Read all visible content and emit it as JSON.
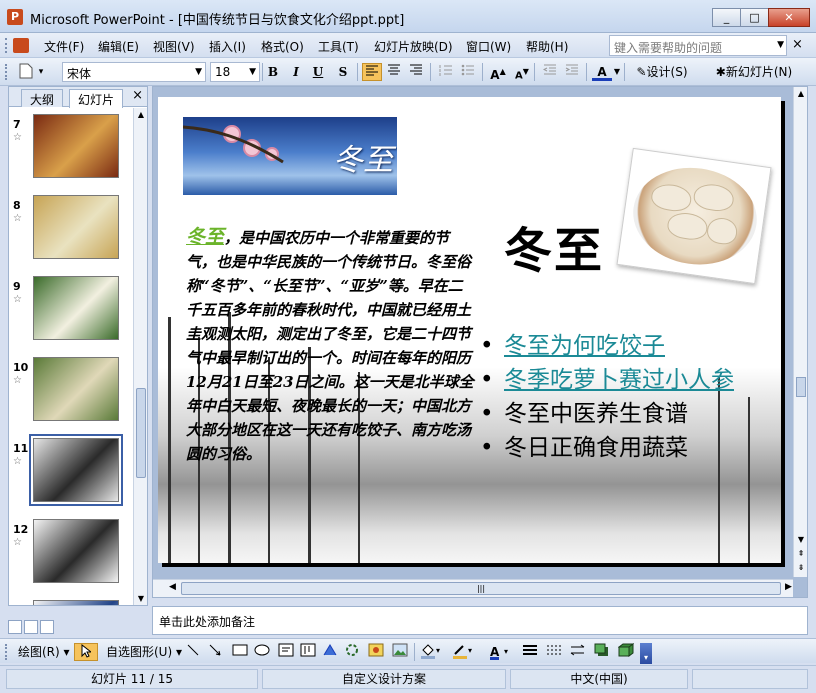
{
  "window": {
    "app_title": "Microsoft PowerPoint - [中国传统节日与饮食文化介绍ppt.ppt]",
    "min": "_",
    "restore": "□",
    "close": "✕"
  },
  "menu": {
    "items": [
      "文件(F)",
      "编辑(E)",
      "视图(V)",
      "插入(I)",
      "格式(O)",
      "工具(T)",
      "幻灯片放映(D)",
      "窗口(W)",
      "帮助(H)"
    ],
    "help_placeholder": "键入需要帮助的问题",
    "close": "×"
  },
  "toolbar": {
    "font": "宋体",
    "size": "18",
    "bold": "B",
    "italic": "I",
    "underline": "U",
    "shadow": "S",
    "design": "设计(S)",
    "new_slide": "新幻灯片(N)"
  },
  "panel": {
    "tab_outline": "大纲",
    "tab_slides": "幻灯片",
    "close": "×"
  },
  "slides": [
    {
      "num": "7",
      "colors": [
        "#7a2a12",
        "#d9a04a"
      ]
    },
    {
      "num": "8",
      "colors": [
        "#c7a455",
        "#e9e2c0"
      ]
    },
    {
      "num": "9",
      "colors": [
        "#3a6b2a",
        "#f2f0e0"
      ]
    },
    {
      "num": "10",
      "colors": [
        "#5a7a38",
        "#e0d8b8"
      ]
    },
    {
      "num": "11",
      "colors": [
        "#e6e6e6",
        "#2a2a2a"
      ]
    },
    {
      "num": "12",
      "colors": [
        "#f4f4f4",
        "#2a2a2a"
      ]
    },
    {
      "num": "13",
      "colors": [
        "#f4f4f4",
        "#224488"
      ]
    }
  ],
  "slide_content": {
    "banner_text": "冬至",
    "heading": "冬至",
    "highlight": "冬至",
    "body": "，是中国农历中一个非常重要的节气，也是中华民族的一个传统节日。冬至俗称“冬节”、“长至节”、“亚岁”等。早在二千五百多年前的春秋时代，中国就已经用土圭观测太阳，测定出了冬至，它是二十四节气中最早制订出的一个。时间在每年的阳历12月21日至23日之间。这一天是北半球全年中白天最短、夜晚最长的一天；中国北方大部分地区在这一天还有吃饺子、南方吃汤圆的习俗。",
    "bullets": [
      {
        "text": "冬至为何吃饺子",
        "link": true
      },
      {
        "text": "冬季吃萝卜赛过小人参",
        "link": true
      },
      {
        "text": "冬至中医养生食谱",
        "link": false
      },
      {
        "text": "冬日正确食用蔬菜",
        "link": false
      }
    ]
  },
  "notes": "单击此处添加备注",
  "drawbar": {
    "draw": "绘图(R)",
    "autoshapes": "自选图形(U)"
  },
  "status": {
    "slide": "幻灯片 11 / 15",
    "design": "自定义设计方案",
    "language": "中文(中国)"
  },
  "colors": {
    "accent_link": "#1b8a96",
    "highlight_green": "#6bb42a",
    "selection": "#3b5fa6"
  }
}
